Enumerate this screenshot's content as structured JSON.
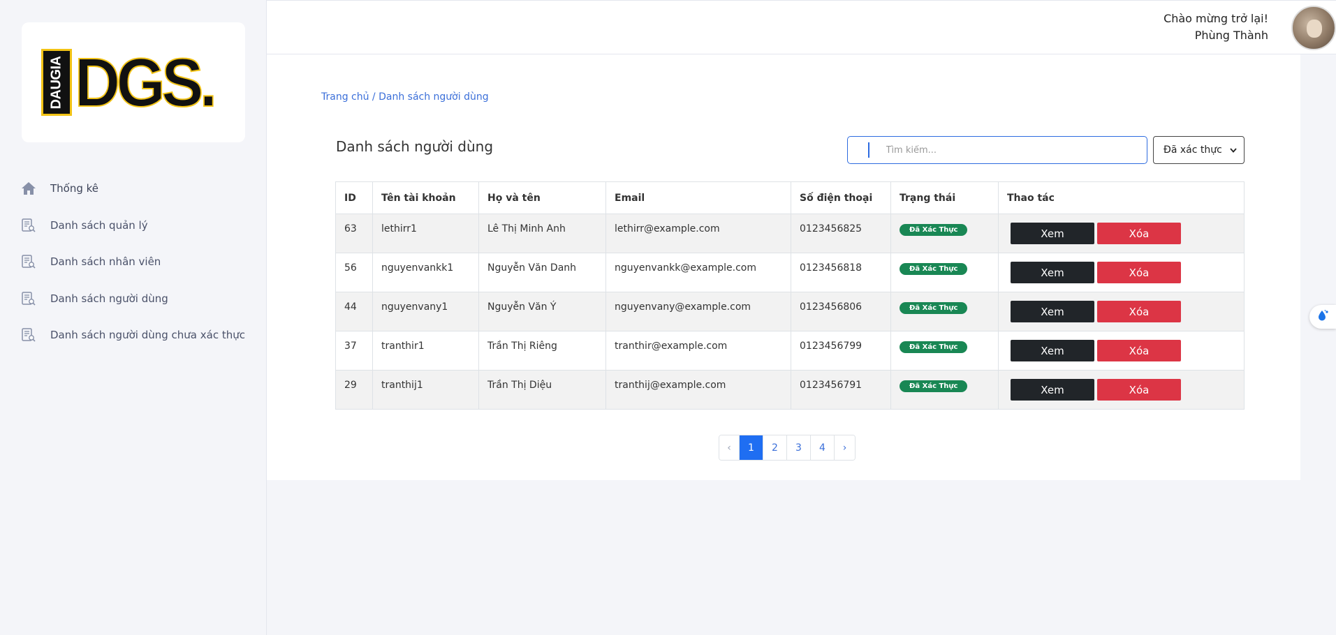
{
  "brand": {
    "logo_vertical": "DAUGIA",
    "logo_main": "DGS.",
    "accent": "#f2c316"
  },
  "sidebar": {
    "items": [
      {
        "label": "Thống kê",
        "icon": "home-icon"
      },
      {
        "label": "Danh sách quản lý",
        "icon": "list-search-icon"
      },
      {
        "label": "Danh sách nhân viên",
        "icon": "list-search-icon"
      },
      {
        "label": "Danh sách người dùng",
        "icon": "list-search-icon"
      },
      {
        "label": "Danh sách người dùng chưa xác thực",
        "icon": "list-search-icon"
      }
    ]
  },
  "header": {
    "greeting": "Chào mừng trở lại!",
    "user_name": "Phùng Thành"
  },
  "main": {
    "breadcrumb": "Trang chủ / Danh sách người dùng",
    "title": "Danh sách người dùng",
    "search_placeholder": "Tìm kiếm...",
    "filter_value": "Đã xác thực",
    "columns": [
      "ID",
      "Tên tài khoản",
      "Họ và tên",
      "Email",
      "Số điện thoại",
      "Trạng thái",
      "Thao tác"
    ],
    "rows": [
      {
        "id": "63",
        "username": "lethirr1",
        "fullname": "Lê Thị Minh Anh",
        "email": "lethirr@example.com",
        "phone": "0123456825",
        "status": "Đã Xác Thực"
      },
      {
        "id": "56",
        "username": "nguyenvankk1",
        "fullname": "Nguyễn Văn Danh",
        "email": "nguyenvankk@example.com",
        "phone": "0123456818",
        "status": "Đã Xác Thực"
      },
      {
        "id": "44",
        "username": "nguyenvany1",
        "fullname": "Nguyễn Văn Ý",
        "email": "nguyenvany@example.com",
        "phone": "0123456806",
        "status": "Đã Xác Thực"
      },
      {
        "id": "37",
        "username": "tranthir1",
        "fullname": "Trần Thị Riêng",
        "email": "tranthir@example.com",
        "phone": "0123456799",
        "status": "Đã Xác Thực"
      },
      {
        "id": "29",
        "username": "tranthij1",
        "fullname": "Trần Thị Diệu",
        "email": "tranthij@example.com",
        "phone": "0123456791",
        "status": "Đã Xác Thực"
      }
    ],
    "view_label": "Xem",
    "delete_label": "Xóa"
  },
  "pagination": {
    "prev": "‹",
    "pages": [
      "1",
      "2",
      "3",
      "4"
    ],
    "next": "›",
    "current": "1"
  },
  "colors": {
    "primary": "#1f6ef2",
    "success": "#198754",
    "danger": "#dc3545",
    "dark": "#212529"
  }
}
